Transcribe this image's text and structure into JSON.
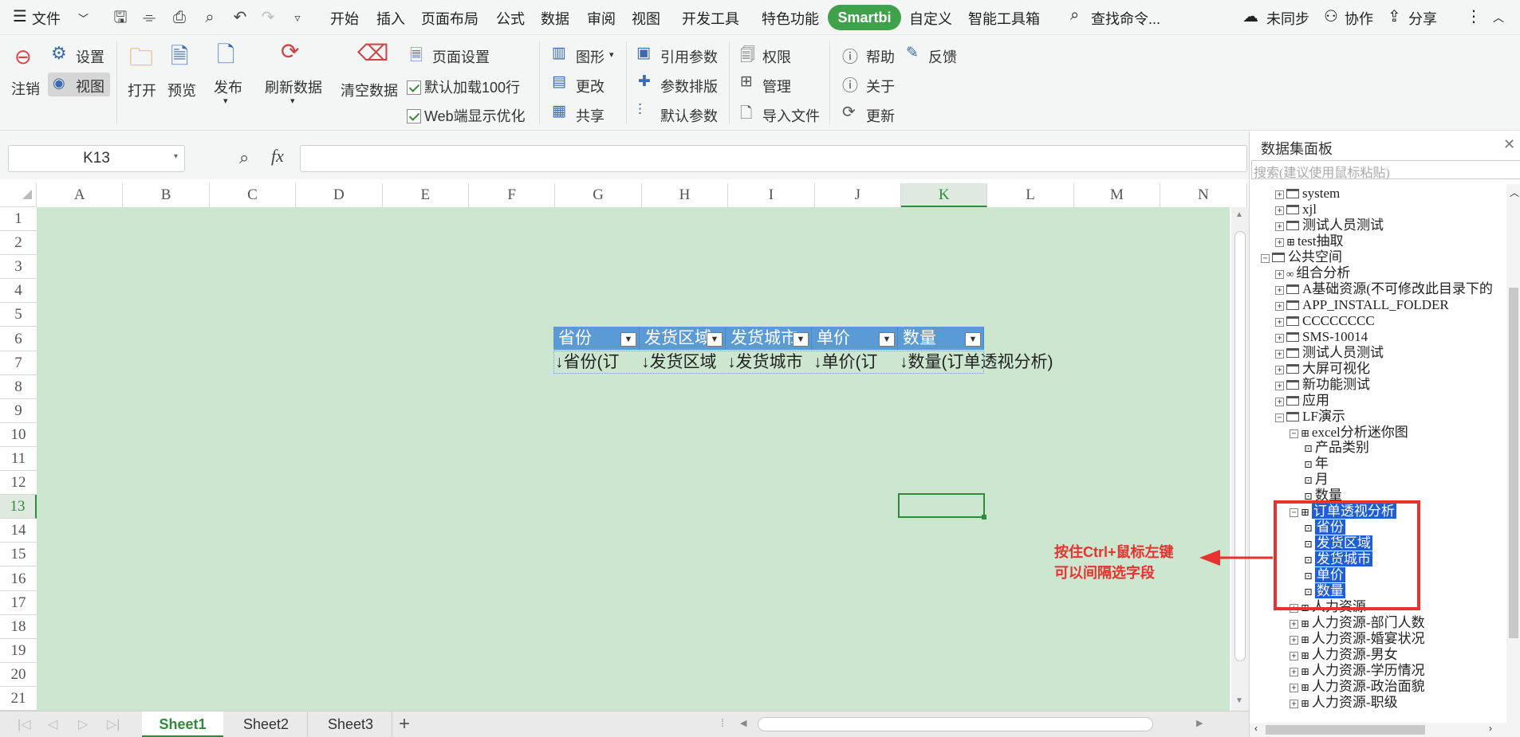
{
  "menubar": {
    "file_label": "文件",
    "items": [
      "开始",
      "插入",
      "页面布局",
      "公式",
      "数据",
      "审阅",
      "视图",
      "开发工具",
      "特色功能"
    ],
    "smartbi_label": "Smartbi",
    "items2": [
      "自定义",
      "智能工具箱"
    ],
    "search_placeholder": "查找命令...",
    "unsync": "未同步",
    "collab": "协作",
    "share": "分享"
  },
  "ribbon": {
    "logout": "注销",
    "settings": "设置",
    "view": "视图",
    "open": "打开",
    "preview": "预览",
    "publish": "发布",
    "refresh": "刷新数据",
    "clear": "清空数据",
    "page_setup": "页面设置",
    "default_load": "默认加载100行",
    "web_opt": "Web端显示优化",
    "chart": "图形",
    "modify": "更改",
    "share": "共享",
    "ref_params": "引用参数",
    "param_layout": "参数排版",
    "default_params": "默认参数",
    "permission": "权限",
    "manage": "管理",
    "import_file": "导入文件",
    "help": "帮助",
    "feedback": "反馈",
    "about": "关于",
    "update": "更新"
  },
  "formula": {
    "cell_ref": "K13",
    "fx": "fx"
  },
  "grid": {
    "columns": [
      "A",
      "B",
      "C",
      "D",
      "E",
      "F",
      "G",
      "H",
      "I",
      "J",
      "K",
      "L",
      "M",
      "N"
    ],
    "rows": [
      "1",
      "2",
      "3",
      "4",
      "5",
      "6",
      "7",
      "8",
      "9",
      "10",
      "11",
      "12",
      "13",
      "14",
      "15",
      "16",
      "17",
      "18",
      "19",
      "20",
      "21"
    ],
    "header_cells": [
      "省份",
      "发货区域",
      "发货城市",
      "单价",
      "数量"
    ],
    "data_cells": [
      "↓省份(订",
      "↓发货区域",
      "↓发货城市",
      "↓单价(订",
      "↓数量(订单透视分析)"
    ]
  },
  "sheets": [
    "Sheet1",
    "Sheet2",
    "Sheet3"
  ],
  "panel": {
    "title": "数据集面板",
    "search_placeholder": "搜索(建议使用鼠标粘贴)",
    "tree": [
      "system",
      "xjl",
      "测试人员测试",
      "test抽取",
      "公共空间",
      "组合分析",
      "A基础资源(不可修改此目录下的",
      "APP_INSTALL_FOLDER",
      "CCCCCCCC",
      "SMS-10014",
      "测试人员测试",
      "大屏可视化",
      "新功能测试",
      "应用",
      "LF演示",
      "excel分析迷你图",
      "产品类别",
      "年",
      "月",
      "数量",
      "订单透视分析",
      "省份",
      "发货区域",
      "发货城市",
      "单价",
      "数量",
      "人力资源",
      "人力资源-部门人数",
      "人力资源-婚宴状况",
      "人力资源-男女",
      "人力资源-学历情况",
      "人力资源-政治面貌",
      "人力资源-职级"
    ],
    "annotation": [
      "按住Ctrl+鼠标左键",
      "可以间隔选字段"
    ]
  },
  "colors": {
    "accent_green": "#3fa24a",
    "header_blue": "#5b9bd5",
    "sheet_bg": "#cde6cf",
    "select_blue": "#1e5fd6",
    "annotation_red": "#e8322f"
  }
}
